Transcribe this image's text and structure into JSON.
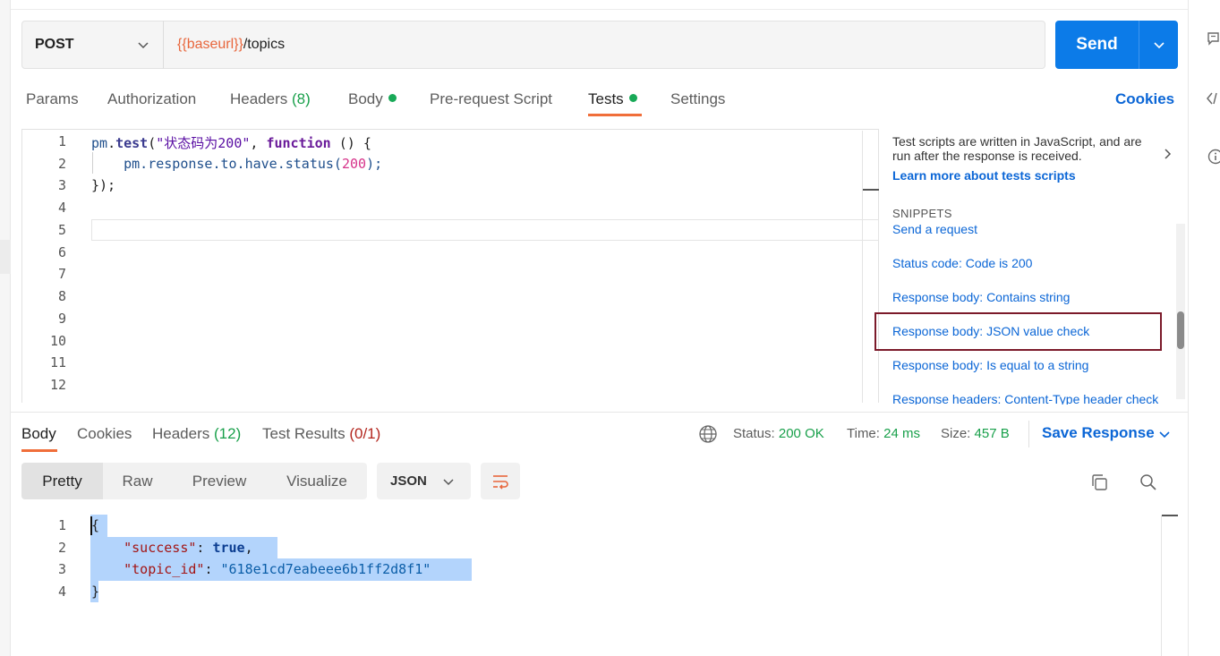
{
  "request": {
    "method": "POST",
    "url_variable": "{{baseurl}}",
    "url_path": "/topics",
    "send_label": "Send"
  },
  "request_tabs": {
    "params": "Params",
    "authorization": "Authorization",
    "headers": "Headers",
    "headers_count": "(8)",
    "body": "Body",
    "prerequest": "Pre-request Script",
    "tests": "Tests",
    "settings": "Settings",
    "cookies": "Cookies"
  },
  "editor": {
    "line_numbers": [
      "1",
      "2",
      "3",
      "4",
      "5",
      "6",
      "7",
      "8",
      "9",
      "10",
      "11",
      "12"
    ],
    "line1": {
      "obj": "pm",
      "dot": ".",
      "fn": "test",
      "open": "(",
      "str": "\"状态码为200\"",
      "comma": ", ",
      "kw": "function",
      "rest": " () {"
    },
    "line2": {
      "prefix": "    pm.response.to.have.status(",
      "num": "200",
      "suffix": ");"
    },
    "line3": "});"
  },
  "side_panel": {
    "description": "Test scripts are written in JavaScript, and are run after the response is received.",
    "learn_more": "Learn more about tests scripts",
    "snippets_title": "SNIPPETS",
    "snippets": [
      "Send a request",
      "Status code: Code is 200",
      "Response body: Contains string",
      "Response body: JSON value check",
      "Response body: Is equal to a string",
      "Response headers: Content-Type header check"
    ]
  },
  "response_tabs": {
    "body": "Body",
    "cookies": "Cookies",
    "headers": "Headers",
    "headers_count": "(12)",
    "test_results": "Test Results",
    "test_count": "(0/1)"
  },
  "response_meta": {
    "status_label": "Status:",
    "status_value": "200 OK",
    "time_label": "Time:",
    "time_value": "24 ms",
    "size_label": "Size:",
    "size_value": "457 B",
    "save_response": "Save Response"
  },
  "view_modes": {
    "pretty": "Pretty",
    "raw": "Raw",
    "preview": "Preview",
    "visualize": "Visualize",
    "format": "JSON"
  },
  "response_body": {
    "line_numbers": [
      "1",
      "2",
      "3",
      "4"
    ],
    "open": "{",
    "success_key": "\"success\"",
    "success_value": "true",
    "topic_key": "\"topic_id\"",
    "topic_value": "\"618e1cd7eabeee6b1ff2d8f1\"",
    "close": "}"
  },
  "colors": {
    "accent": "#0c7be8",
    "tab_underline": "#f06e3a",
    "status_green": "#19a04b",
    "fail_red": "#b3261e",
    "variable_orange": "#e8663c"
  }
}
